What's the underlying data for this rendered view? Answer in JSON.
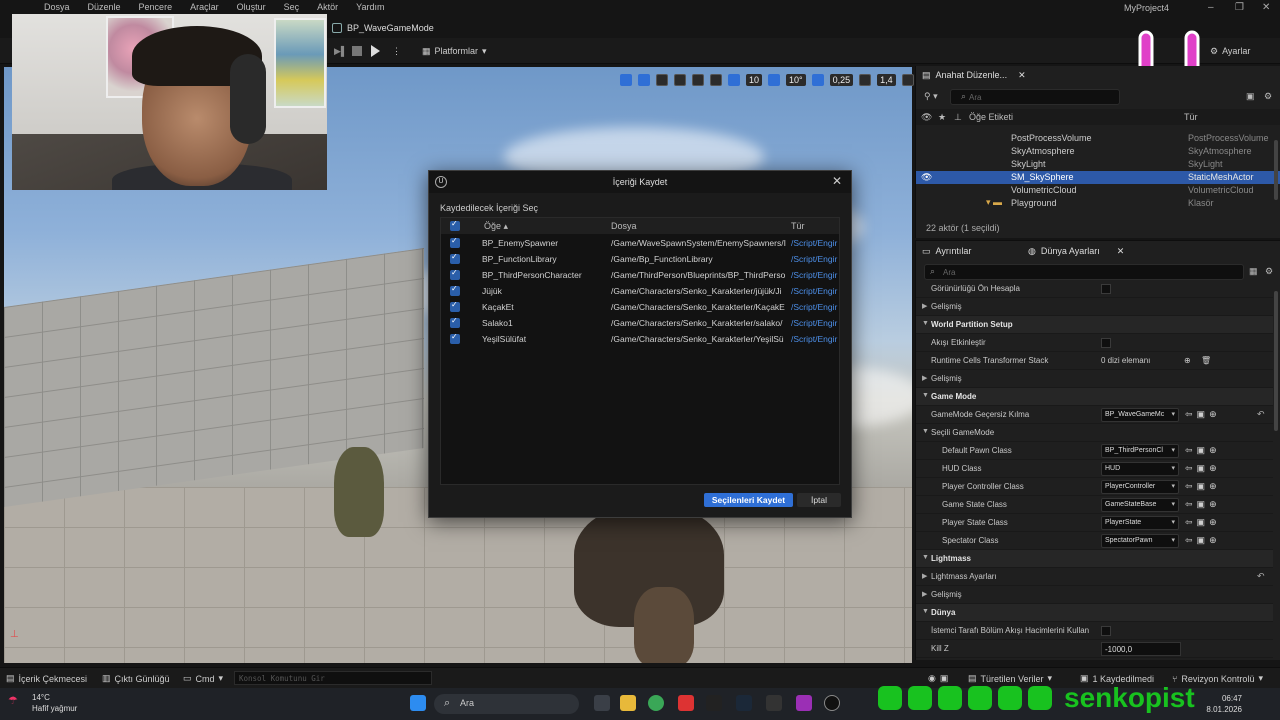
{
  "menubar": {
    "items": [
      "Dosya",
      "Düzenle",
      "Pencere",
      "Araçlar",
      "Oluştur",
      "Seç",
      "Aktör",
      "Yardım"
    ],
    "project": "MyProject4"
  },
  "tab": {
    "title": "BP_WaveGameMode"
  },
  "toolbar": {
    "platforms": "Platformlar",
    "settings": "Ayarlar"
  },
  "viewport_toolbar": {
    "grid": "10",
    "angle": "10°",
    "scale": "0,25",
    "speed": "1,4"
  },
  "outliner": {
    "tab": "Anahat Düzenle...",
    "search_placeholder": "Ara",
    "col_label": "Öğe Etiketi",
    "col_type": "Tür",
    "rows": [
      {
        "name": "PostProcessVolume",
        "type": "PostProcessVolume"
      },
      {
        "name": "SkyAtmosphere",
        "type": "SkyAtmosphere"
      },
      {
        "name": "SkyLight",
        "type": "SkyLight"
      },
      {
        "name": "SM_SkySphere",
        "type": "StaticMeshActor"
      },
      {
        "name": "VolumetricCloud",
        "type": "VolumetricCloud"
      },
      {
        "name": "Playground",
        "type": "Klasör"
      }
    ],
    "footer": "22 aktör (1 seçildi)"
  },
  "details": {
    "tab1": "Ayrıntılar",
    "tab2": "Dünya Ayarları",
    "search_placeholder": "Ara",
    "rows": {
      "r0": "Görünürlüğü Ön Hesapla",
      "r1": "Gelişmiş",
      "r2": "World Partition Setup",
      "r3": "Akışı Etkinleştir",
      "r4": "Runtime Cells Transformer Stack",
      "r4v": "0 dizi elemanı",
      "r5": "Gelişmiş",
      "r6": "Game Mode",
      "r7": "GameMode Geçersiz Kılma",
      "r7v": "BP_WaveGameMc",
      "r8": "Seçili GameMode",
      "r9": "Default Pawn Class",
      "r9v": "BP_ThirdPersonCl",
      "r10": "HUD Class",
      "r10v": "HUD",
      "r11": "Player Controller Class",
      "r11v": "PlayerController",
      "r12": "Game State Class",
      "r12v": "GameStateBase",
      "r13": "Player State Class",
      "r13v": "PlayerState",
      "r14": "Spectator Class",
      "r14v": "SpectatorPawn",
      "r15": "Lightmass",
      "r16": "Lightmass Ayarları",
      "r17": "Gelişmiş",
      "r18": "Dünya",
      "r19": "İstemci Tarafı Bölüm Akışı Hacimlerini Kullan",
      "r20": "Kill Z",
      "r20v": "-1000,0"
    }
  },
  "dialog": {
    "title": "İçeriği Kaydet",
    "subtitle": "Kaydedilecek İçeriği Seç",
    "col_item": "Öğe",
    "col_file": "Dosya",
    "col_type": "Tür",
    "rows": [
      {
        "item": "BP_EnemySpawner",
        "file": "/Game/WaveSpawnSystem/EnemySpawners/I",
        "type": "/Script/Engir"
      },
      {
        "item": "BP_FunctionLibrary",
        "file": "/Game/Bp_FunctionLibrary",
        "type": "/Script/Engir"
      },
      {
        "item": "BP_ThirdPersonCharacter",
        "file": "/Game/ThirdPerson/Blueprints/BP_ThirdPerso",
        "type": "/Script/Engir"
      },
      {
        "item": "Jüjük",
        "file": "/Game/Characters/Senko_Karakterler/jüjük/Ji",
        "type": "/Script/Engir"
      },
      {
        "item": "KaçakEt",
        "file": "/Game/Characters/Senko_Karakterler/KaçakE",
        "type": "/Script/Engir"
      },
      {
        "item": "Salako1",
        "file": "/Game/Characters/Senko_Karakterler/salako/",
        "type": "/Script/Engir"
      },
      {
        "item": "YeşilSülüfat",
        "file": "/Game/Characters/Senko_Karakterler/YeşilSü",
        "type": "/Script/Engir"
      }
    ],
    "save_label": "Seçilenleri Kaydet",
    "cancel_label": "İptal"
  },
  "statusbar": {
    "content_drawer": "İçerik Çekmecesi",
    "output_log": "Çıktı Günlüğü",
    "cmd": "Cmd",
    "console_placeholder": "Konsol Komutunu Gir",
    "derived": "Türetilen Veriler",
    "unsaved": "1 Kaydedilmedi",
    "revision": "Revizyon Kontrolü"
  },
  "taskbar": {
    "temp": "14°C",
    "weather": "Hafif yağmur",
    "search": "Ara",
    "time": "06:47",
    "date": "8.01.2026"
  },
  "overlay": {
    "brand": "senkopist"
  },
  "colors": {
    "accent": "#2f6fd6",
    "selection": "#2d59a8",
    "brand_green": "#18c21f",
    "smile_pink": "#e040c8"
  }
}
